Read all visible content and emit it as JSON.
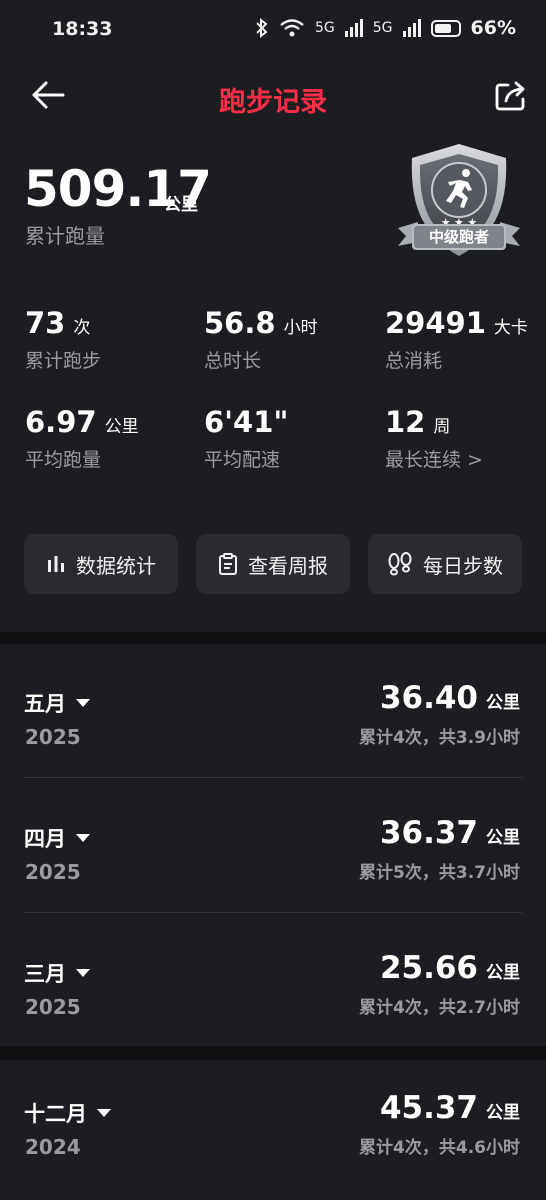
{
  "status_bar": {
    "time": "18:33",
    "battery": "66%",
    "signal_1": "5G",
    "signal_2": "5G",
    "icons": [
      "bluetooth-icon",
      "wifi-icon",
      "signal-icon",
      "signal-icon",
      "battery-icon"
    ]
  },
  "header": {
    "title": "跑步记录",
    "back_icon": "arrow-left-icon",
    "share_icon": "share-icon"
  },
  "summary": {
    "total_distance": "509.17",
    "total_unit": "公里",
    "total_label": "累计跑量",
    "badge_label": "中级跑者",
    "badge_stars": "★★★"
  },
  "stats": [
    {
      "value": "73",
      "unit": "次",
      "label": "累计跑步"
    },
    {
      "value": "56.8",
      "unit": "小时",
      "label": "总时长"
    },
    {
      "value": "29491",
      "unit": "大卡",
      "label": "总消耗"
    },
    {
      "value": "6.97",
      "unit": "公里",
      "label": "平均跑量"
    },
    {
      "value": "6'41\"",
      "unit": "",
      "label": "平均配速"
    },
    {
      "value": "12",
      "unit": "周",
      "label": "最长连续 >"
    }
  ],
  "quick_buttons": [
    {
      "label": "数据统计",
      "icon": "bar-chart-icon"
    },
    {
      "label": "查看周报",
      "icon": "clipboard-icon"
    },
    {
      "label": "每日步数",
      "icon": "footprints-icon"
    }
  ],
  "months": [
    {
      "month": "五月",
      "year": "2025",
      "distance": "36.40",
      "unit": "公里",
      "summary": "累计4次，共3.9小时"
    },
    {
      "month": "四月",
      "year": "2025",
      "distance": "36.37",
      "unit": "公里",
      "summary": "累计5次，共3.7小时"
    },
    {
      "month": "三月",
      "year": "2025",
      "distance": "25.66",
      "unit": "公里",
      "summary": "累计4次，共2.7小时"
    },
    {
      "month": "十二月",
      "year": "2024",
      "distance": "45.37",
      "unit": "公里",
      "summary": "累计4次，共4.6小时"
    }
  ],
  "colors": {
    "accent": "#ff2e46",
    "panel": "#1c1d21",
    "background": "#0f1012",
    "muted": "#9a9ba0"
  }
}
